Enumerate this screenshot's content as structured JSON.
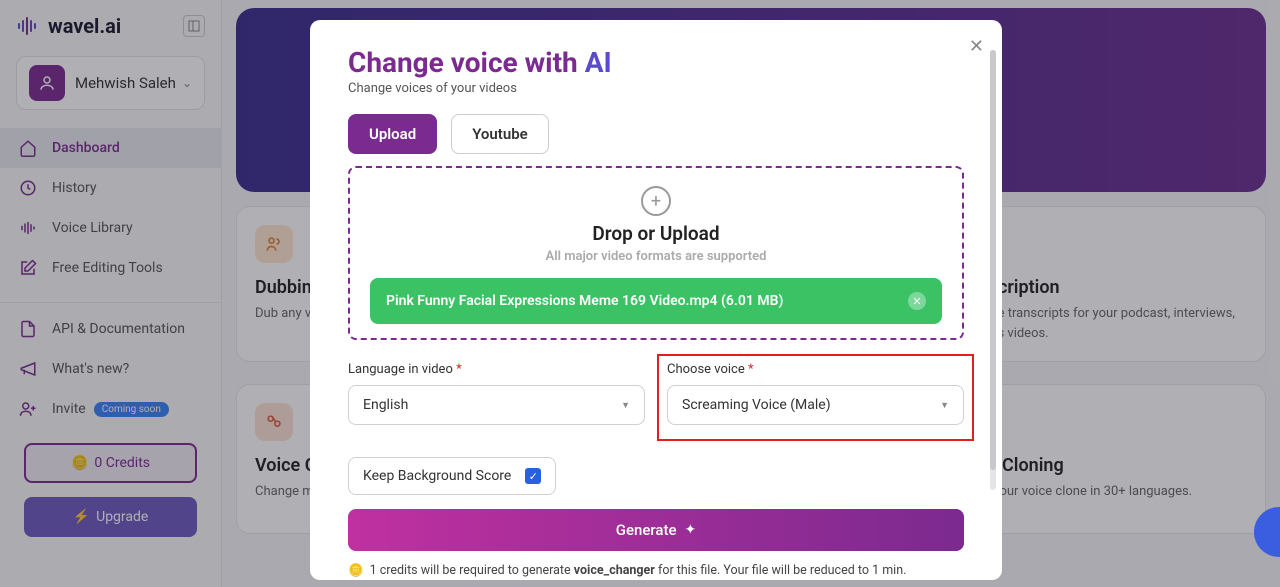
{
  "brand": "wavel.ai",
  "user": {
    "name": "Mehwish Saleh"
  },
  "nav": {
    "dashboard": "Dashboard",
    "history": "History",
    "voice_library": "Voice Library",
    "free_editing": "Free Editing Tools",
    "api_docs": "API & Documentation",
    "whats_new": "What's new?",
    "invite": "Invite",
    "invite_badge": "Coming soon"
  },
  "credits": {
    "label": "0 Credits"
  },
  "upgrade": "Upgrade",
  "cards": {
    "dubbing": {
      "title": "Dubbing",
      "sub": "Dub any vid"
    },
    "transcription": {
      "title": "Transcription",
      "sub": "Generate transcripts for your podcast, interviews, business videos."
    },
    "voice_ch": {
      "title": "Voice Ch",
      "sub": "Change ma"
    },
    "voice_cloning": {
      "title": "Voice Cloning",
      "sub": "Create your voice clone in 30+ languages."
    }
  },
  "modal": {
    "title_main": "Change voice with ",
    "title_ai": "AI",
    "sub": "Change voices of your videos",
    "tab_upload": "Upload",
    "tab_youtube": "Youtube",
    "drop_title": "Drop or Upload",
    "drop_sub": "All major video formats are supported",
    "file_name": "Pink Funny Facial Expressions Meme 169 Video.mp4 (6.01 MB)",
    "lang_label": "Language in video ",
    "lang_value": "English",
    "voice_label": "Choose voice ",
    "voice_value": "Screaming Voice (Male)",
    "bg_score": "Keep Background Score",
    "generate": "Generate",
    "credits_note_1": "1 credits will be required to generate ",
    "credits_note_bold": "voice_changer",
    "credits_note_2": " for this file. Your file will be reduced to 1 min."
  }
}
